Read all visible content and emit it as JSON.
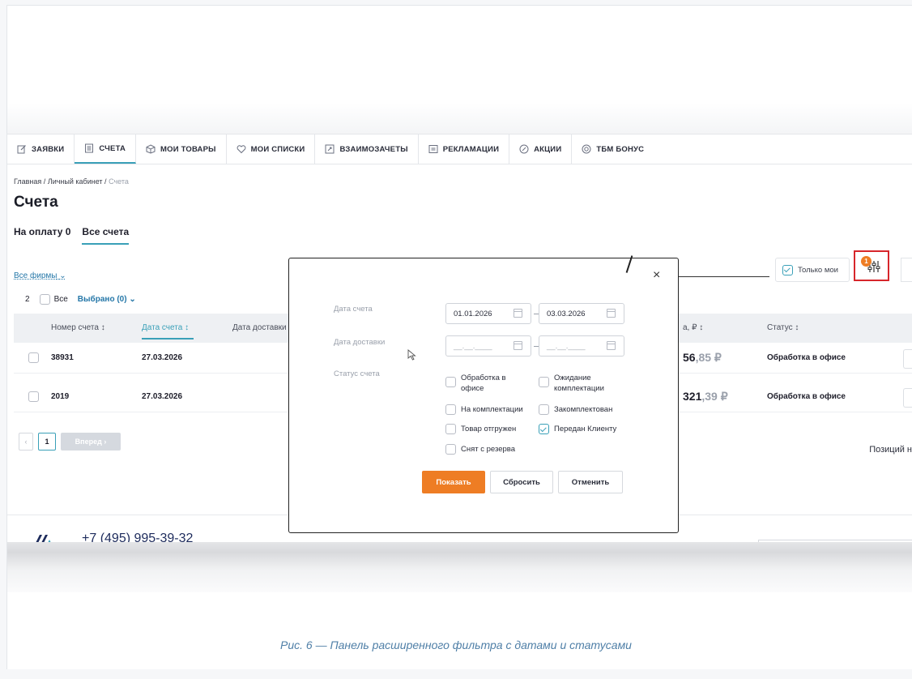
{
  "nav": [
    {
      "label": "ЗАЯВКИ",
      "icon": "edit-icon"
    },
    {
      "label": "СЧЕТА",
      "icon": "document-icon",
      "active": true
    },
    {
      "label": "МОИ ТОВАРЫ",
      "icon": "box-icon"
    },
    {
      "label": "МОИ СПИСКИ",
      "icon": "heart-icon"
    },
    {
      "label": "ВЗАИМОЗАЧЕТЫ",
      "icon": "exchange-icon"
    },
    {
      "label": "РЕКЛАМАЦИИ",
      "icon": "message-icon"
    },
    {
      "label": "АКЦИИ",
      "icon": "percent-icon"
    },
    {
      "label": "ТБМ БОНУС",
      "icon": "coin-icon"
    }
  ],
  "breadcrumb": {
    "home": "Главная",
    "sep": "/",
    "cabinet": "Личный кабинет",
    "current": "Счета"
  },
  "page_title": "Счета",
  "tabs": {
    "to_pay": "На оплату 0",
    "all": "Все счета"
  },
  "firms_label": "Все фирмы",
  "selection": {
    "count": "2",
    "all_label": "Все",
    "selected": "Выбрано (0)"
  },
  "table": {
    "headers": {
      "number": "Номер счета",
      "date": "Дата счета",
      "delivery": "Дата доставки",
      "sum": "а, ₽",
      "status": "Статус"
    },
    "sort_mark": "↕",
    "rows": [
      {
        "number": "38931",
        "date": "27.03.2026",
        "sum_int": "56",
        "sum_dec": ",85 ₽",
        "status": "Обработка в офисе"
      },
      {
        "number": "2019",
        "date": "27.03.2026",
        "sum_int": "321",
        "sum_dec": ",39 ₽",
        "status": "Обработка в офисе"
      }
    ]
  },
  "pager": {
    "prev": "‹",
    "page": "1",
    "next": "Вперед ›"
  },
  "positions_label": "Позиций н",
  "only_mine": "Только мои",
  "filter_badge": "1",
  "footer": {
    "phone": "+7 (495) 995-39-32"
  },
  "modal": {
    "date_label": "Дата счета",
    "date_from": "01.01.2026",
    "date_to": "03.03.2026",
    "delivery_label": "Дата доставки",
    "delivery_from": "__.__.____",
    "delivery_to": "__.__.____",
    "status_label": "Статус счета",
    "statuses": [
      {
        "label": "Обработка в\nофисе",
        "checked": false
      },
      {
        "label": "Ожидание\nкомплектации",
        "checked": false
      },
      {
        "label": "На комплектации",
        "checked": false
      },
      {
        "label": "Закомплектован",
        "checked": false
      },
      {
        "label": "Товар отгружен",
        "checked": false
      },
      {
        "label": "Передан Клиенту",
        "checked": true
      },
      {
        "label": "Снят с резерва",
        "checked": false
      }
    ],
    "show": "Показать",
    "reset": "Сбросить",
    "cancel": "Отменить",
    "close": "×"
  },
  "caption": "Рис. 6 — Панель расширенного фильтра с датами и статусами",
  "colors": {
    "accent": "#3aa0b8",
    "orange": "#ee7d24",
    "highlight": "#d7262b"
  }
}
